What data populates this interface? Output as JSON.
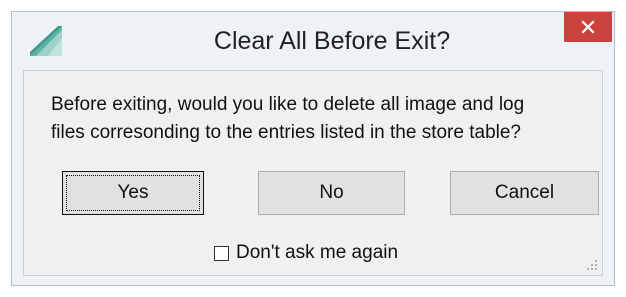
{
  "window": {
    "title": "Clear All Before Exit?",
    "accent_color": "#c9423c",
    "icon": "app-logo-icon",
    "close_icon": "close-icon"
  },
  "message": {
    "line1": "Before exiting, would you like to delete all image and log",
    "line2": "files corresonding to the entries listed in the store table?"
  },
  "buttons": {
    "yes_label": "Yes",
    "no_label": "No",
    "cancel_label": "Cancel",
    "default": "Yes"
  },
  "checkbox": {
    "label": "Don't ask me again",
    "checked": false
  }
}
